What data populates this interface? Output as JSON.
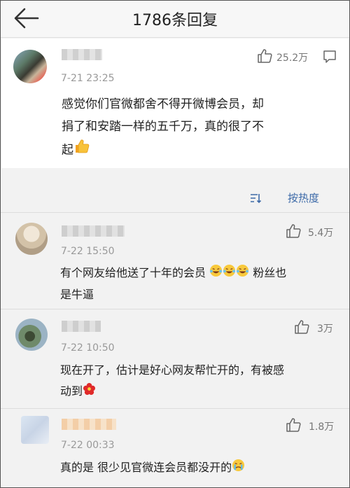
{
  "header": {
    "title": "1786条回复"
  },
  "pinned": {
    "time": "7-21 23:25",
    "likes": "25.2万",
    "text_lines": [
      "感觉你们官微都舍不得开微博会员，却",
      "捐了和安踏一样的五千万，真的很了不",
      "起"
    ]
  },
  "sort": {
    "label": "按热度"
  },
  "replies": [
    {
      "time": "7-22 15:50",
      "likes": "5.4万",
      "text_lines": [
        "有个网友给他送了十年的会员",
        "粉丝也",
        "是牛逼"
      ]
    },
    {
      "time": "7-22 10:50",
      "likes": "3万",
      "text_lines": [
        "现在开了，估计是好心网友帮忙开的，有被感",
        "动到"
      ]
    },
    {
      "time": "7-22 00:33",
      "likes": "1.8万",
      "text_lines": [
        "真的是  很少见官微连会员都没开的"
      ]
    }
  ],
  "colors": {
    "link": "#3d6aa8",
    "background": "#f2f2f2"
  }
}
